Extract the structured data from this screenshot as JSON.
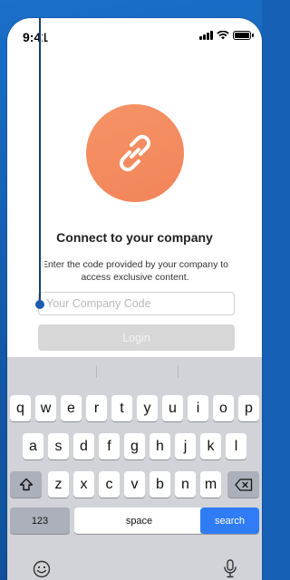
{
  "status": {
    "time": "9:41"
  },
  "card": {
    "heading": "Connect to your company",
    "subtext": "Enter the code provided by your company to access exclusive content.",
    "code_placeholder": "Your Company Code",
    "login_label": "Login"
  },
  "keyboard": {
    "row1": [
      "q",
      "w",
      "e",
      "r",
      "t",
      "y",
      "u",
      "i",
      "o",
      "p"
    ],
    "row2": [
      "a",
      "s",
      "d",
      "f",
      "g",
      "h",
      "j",
      "k",
      "l"
    ],
    "row3": [
      "z",
      "x",
      "c",
      "v",
      "b",
      "n",
      "m"
    ],
    "numbers_label": "123",
    "space_label": "space",
    "search_label": "search"
  },
  "colors": {
    "accent": "#f2845a",
    "background": "#1660b5",
    "search_key": "#2f7cf6"
  },
  "icons": [
    "link-icon",
    "shift-icon",
    "backspace-icon",
    "emoji-icon",
    "microphone-icon",
    "signal-icon",
    "wifi-icon",
    "battery-icon"
  ]
}
